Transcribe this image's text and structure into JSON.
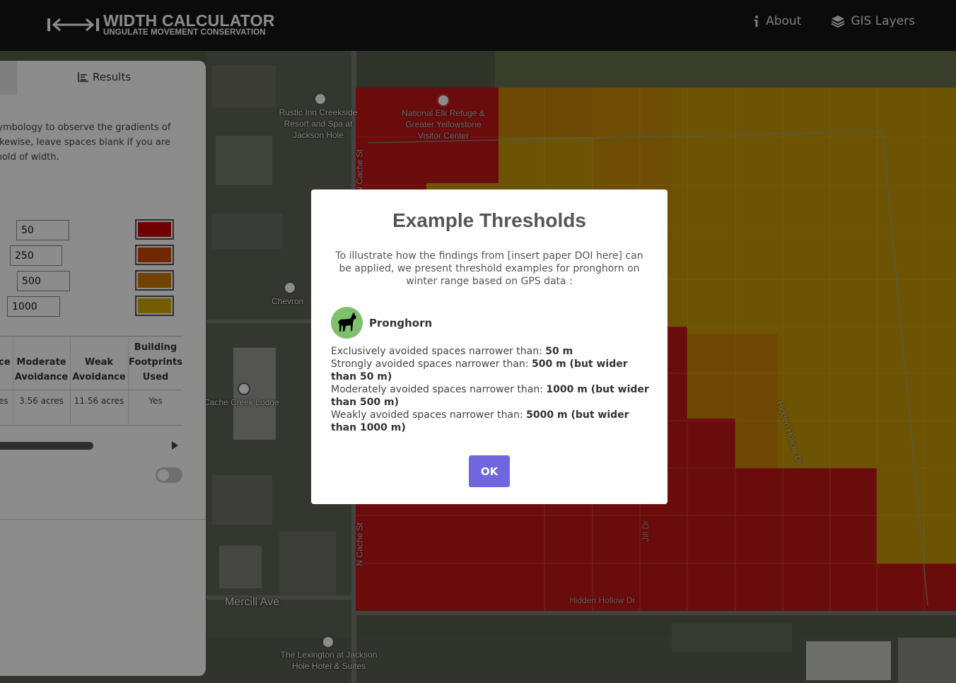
{
  "header": {
    "app_title": "WIDTH CALCULATOR",
    "app_subtitle": "UNGULATE MOVEMENT CONSERVATION",
    "nav": [
      {
        "label": "About",
        "icon": "info-icon"
      },
      {
        "label": "GIS Layers",
        "icon": "layers-icon"
      }
    ]
  },
  "panel": {
    "tabs": [
      {
        "label": "Results",
        "icon": "bar-chart-icon"
      }
    ],
    "description_lines": [
      "r symbology to observe the gradients of",
      ". Likewise, leave spaces blank if you are",
      "eshold of width."
    ],
    "thresholds": [
      {
        "value": "50",
        "color": "#cc0000"
      },
      {
        "value": "250",
        "color": "#cc4a00"
      },
      {
        "value": "500",
        "color": "#cc7a00"
      },
      {
        "value": "1000",
        "color": "#d4aa00"
      }
    ],
    "table": {
      "headers": [
        {
          "line1": "",
          "line2": "ce"
        },
        {
          "line1": "Moderate",
          "line2": "Avoidance"
        },
        {
          "line1": "Weak",
          "line2": "Avoidance"
        },
        {
          "line1": "Building",
          "line2": "Footprints",
          "line3": "Used"
        }
      ],
      "row": [
        "es",
        "3.56 acres",
        "11.56 acres",
        "Yes"
      ]
    }
  },
  "map": {
    "labels": [
      {
        "text": "Rustic Inn Creekside\nResort and Spa at\nJackson Hole"
      },
      {
        "text": "National Elk Refuge &\nGreater Yellowstone\nVisitor Center"
      },
      {
        "text": "Chevron"
      },
      {
        "text": "Cache Creek Lodge"
      },
      {
        "text": "Mercill Ave"
      },
      {
        "text": "The Lexington at Jackson\nHole Hotel & Suites"
      },
      {
        "text": "N Cache St"
      },
      {
        "text": "N Cache St"
      },
      {
        "text": "Hidden Hollow Dr"
      },
      {
        "text": "Hidden Hollow Dr"
      },
      {
        "text": "Jill Dr"
      }
    ]
  },
  "modal": {
    "title": "Example Thresholds",
    "description": "To illustrate how the findings from [insert paper DOI here] can be applied, we present threshold examples for pronghorn on winter range based on GPS data :",
    "species": "Pronghorn",
    "thresholds": [
      {
        "label": "Exclusively avoided spaces narrower than: ",
        "value": "50 m"
      },
      {
        "label": "Strongly avoided spaces narrower than: ",
        "value": "500 m (but wider than 50 m)"
      },
      {
        "label": "Moderately avoided spaces narrower than: ",
        "value": "1000 m (but wider than 500 m)"
      },
      {
        "label": "Weakly avoided spaces narrower than: ",
        "value": "5000 m (but wider than 1000 m)"
      }
    ],
    "ok_label": "OK"
  }
}
